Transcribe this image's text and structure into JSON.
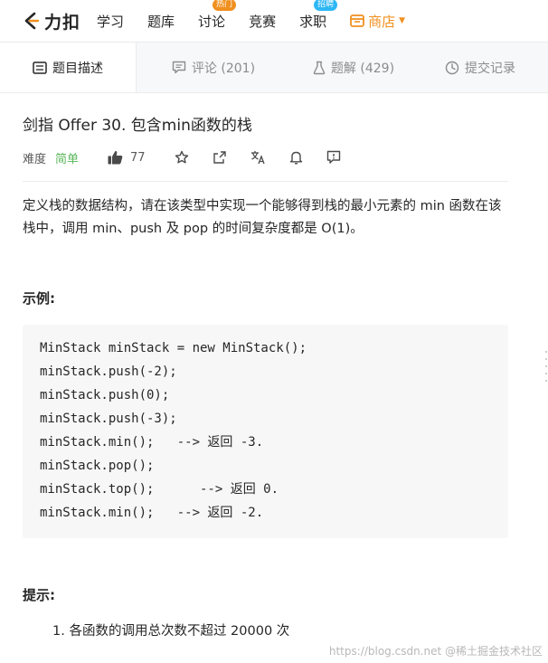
{
  "nav": {
    "logo_text": "力扣",
    "items": [
      {
        "label": "学习",
        "badge": ""
      },
      {
        "label": "题库",
        "badge": ""
      },
      {
        "label": "讨论",
        "badge": "热门"
      },
      {
        "label": "竞赛",
        "badge": ""
      },
      {
        "label": "求职",
        "badge": "招聘"
      }
    ],
    "shop_label": "商店",
    "accent_color": "#f0901f"
  },
  "tabs": [
    {
      "label": "题目描述",
      "icon": "description-icon"
    },
    {
      "label": "评论 (201)",
      "icon": "comment-icon"
    },
    {
      "label": "题解 (429)",
      "icon": "flask-icon"
    },
    {
      "label": "提交记录",
      "icon": "clock-icon"
    }
  ],
  "problem": {
    "title": "剑指 Offer 30. 包含min函数的栈",
    "difficulty_label": "难度",
    "difficulty": "简单",
    "likes": "77",
    "description": "定义栈的数据结构，请在该类型中实现一个能够得到栈的最小元素的 min 函数在该栈中，调用 min、push 及 pop 的时间复杂度都是 O(1)。",
    "example_heading": "示例:",
    "code_lines": [
      "MinStack minStack = new MinStack();",
      "minStack.push(-2);",
      "minStack.push(0);",
      "minStack.push(-3);",
      "minStack.min();   --> 返回 -3.",
      "minStack.pop();",
      "minStack.top();      --> 返回 0.",
      "minStack.min();   --> 返回 -2."
    ],
    "hint_heading": "提示:",
    "hint_item": "1. 各函数的调用总次数不超过 20000 次"
  },
  "watermark": "https://blog.csdn.net @稀土掘金技术社区"
}
